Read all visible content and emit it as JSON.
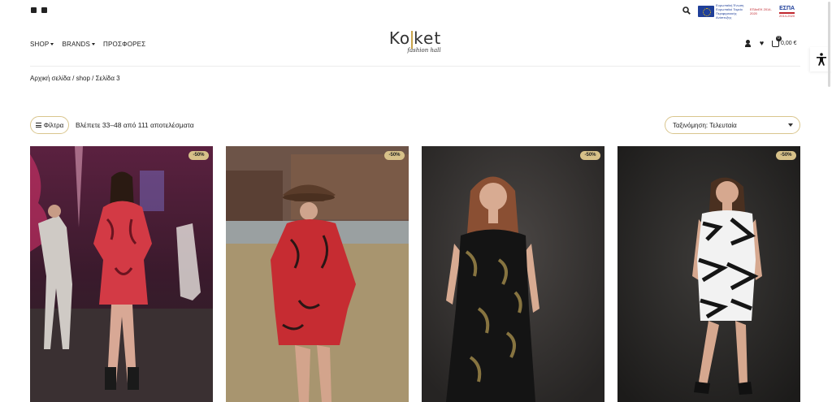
{
  "topbar": {
    "social_icons": [
      "facebook-icon",
      "instagram-icon"
    ],
    "espa": {
      "eu_text": "Ευρωπαϊκή Ένωση",
      "fund_text": "Ευρωπαϊκό Ταμείο Περιφερειακής Ανάπτυξης",
      "program_text": "ΕΠΑνΕΚ 2014-2020",
      "espa_label": "ΕΣΠΑ",
      "espa_years": "2014-2020"
    }
  },
  "nav": {
    "shop": "SHOP",
    "brands": "BRANDS",
    "offers": "ΠΡΟΣΦΟΡΕΣ"
  },
  "logo": {
    "main_left": "Ko",
    "main_right": "ket",
    "sub": "fashion hall"
  },
  "cart": {
    "count": "0",
    "total": "0,00 €"
  },
  "breadcrumb": "Αρχική σελίδα / shop / Σελίδα 3",
  "toolbar": {
    "filter_label": "Φίλτρα",
    "results_text": "Βλέπετε 33–48 από 111 αποτελέσματα",
    "sort_value": "Ταξινόμηση: Τελευταία"
  },
  "products": [
    {
      "badge": "-50%"
    },
    {
      "badge": "-50%"
    },
    {
      "badge": "-50%"
    },
    {
      "badge": "-50%"
    }
  ],
  "colors": {
    "accent_gold": "#d7c189",
    "border_gold": "#d9c58d",
    "text": "#222222"
  }
}
